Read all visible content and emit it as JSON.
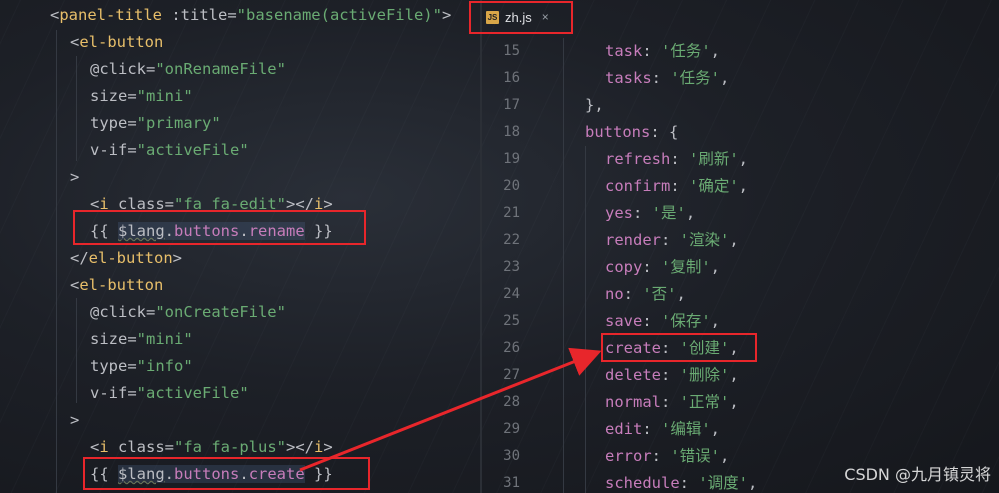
{
  "tab": {
    "icon_label": "JS",
    "name": "zh.js",
    "close": "×"
  },
  "left_lines": [
    {
      "parts": [
        [
          "t-punc",
          "<"
        ],
        [
          "t-tag",
          "panel-title "
        ],
        [
          "t-attr",
          ":title="
        ],
        [
          "t-str",
          "\"basename(activeFile)\""
        ],
        [
          "t-punc",
          ">"
        ]
      ]
    },
    {
      "parts": [
        [
          "t-punc",
          "<"
        ],
        [
          "t-tag",
          "el-button"
        ]
      ]
    },
    {
      "parts": [
        [
          "t-attr",
          "@click="
        ],
        [
          "t-str",
          "\"onRenameFile\""
        ]
      ]
    },
    {
      "parts": [
        [
          "t-attr",
          "size="
        ],
        [
          "t-str",
          "\"mini\""
        ]
      ]
    },
    {
      "parts": [
        [
          "t-attr",
          "type="
        ],
        [
          "t-str",
          "\"primary\""
        ]
      ]
    },
    {
      "parts": [
        [
          "t-attr",
          "v-if="
        ],
        [
          "t-str",
          "\"activeFile\""
        ]
      ]
    },
    {
      "parts": [
        [
          "t-punc",
          ">"
        ]
      ]
    },
    {
      "parts": [
        [
          "t-punc",
          "<"
        ],
        [
          "t-tag",
          "i "
        ],
        [
          "t-attr",
          "class="
        ],
        [
          "t-str",
          "\"fa fa-edit\""
        ],
        [
          "t-punc",
          "></"
        ],
        [
          "t-tag",
          "i"
        ],
        [
          "t-punc",
          ">"
        ]
      ]
    },
    {
      "parts": [
        [
          "t-punc",
          "{{ "
        ],
        [
          "t-var",
          "$lang"
        ],
        [
          "t-punc",
          "."
        ],
        [
          "t-prop",
          "buttons"
        ],
        [
          "t-punc",
          "."
        ],
        [
          "t-prop",
          "rename"
        ],
        [
          "t-punc",
          " }}"
        ]
      ]
    },
    {
      "parts": [
        [
          "t-punc",
          "</"
        ],
        [
          "t-tag",
          "el-button"
        ],
        [
          "t-punc",
          ">"
        ]
      ]
    },
    {
      "parts": [
        [
          "t-punc",
          "<"
        ],
        [
          "t-tag",
          "el-button"
        ]
      ]
    },
    {
      "parts": [
        [
          "t-attr",
          "@click="
        ],
        [
          "t-str",
          "\"onCreateFile\""
        ]
      ]
    },
    {
      "parts": [
        [
          "t-attr",
          "size="
        ],
        [
          "t-str",
          "\"mini\""
        ]
      ]
    },
    {
      "parts": [
        [
          "t-attr",
          "type="
        ],
        [
          "t-str",
          "\"info\""
        ]
      ]
    },
    {
      "parts": [
        [
          "t-attr",
          "v-if="
        ],
        [
          "t-str",
          "\"activeFile\""
        ]
      ]
    },
    {
      "parts": [
        [
          "t-punc",
          ">"
        ]
      ]
    },
    {
      "parts": [
        [
          "t-punc",
          "<"
        ],
        [
          "t-tag",
          "i "
        ],
        [
          "t-attr",
          "class="
        ],
        [
          "t-str",
          "\"fa fa-plus\""
        ],
        [
          "t-punc",
          "></"
        ],
        [
          "t-tag",
          "i"
        ],
        [
          "t-punc",
          ">"
        ]
      ]
    },
    {
      "parts": [
        [
          "t-punc",
          "{{ "
        ],
        [
          "t-var",
          "$lang"
        ],
        [
          "t-punc",
          "."
        ],
        [
          "t-prop",
          "buttons"
        ],
        [
          "t-punc",
          "."
        ],
        [
          "t-prop",
          "create"
        ],
        [
          "t-punc",
          " }}"
        ]
      ]
    }
  ],
  "right_lines": [
    {
      "num": "15",
      "parts": [
        [
          "t-key",
          "task"
        ],
        [
          "t-punc",
          ": "
        ],
        [
          "t-str",
          "'任务'"
        ],
        [
          "t-punc",
          ","
        ]
      ]
    },
    {
      "num": "16",
      "parts": [
        [
          "t-key",
          "tasks"
        ],
        [
          "t-punc",
          ": "
        ],
        [
          "t-str",
          "'任务'"
        ],
        [
          "t-punc",
          ","
        ]
      ]
    },
    {
      "num": "17",
      "parts": [
        [
          "t-punc",
          "},"
        ]
      ]
    },
    {
      "num": "18",
      "parts": [
        [
          "t-key",
          "buttons"
        ],
        [
          "t-punc",
          ": {"
        ]
      ]
    },
    {
      "num": "19",
      "parts": [
        [
          "t-key",
          "refresh"
        ],
        [
          "t-punc",
          ": "
        ],
        [
          "t-str",
          "'刷新'"
        ],
        [
          "t-punc",
          ","
        ]
      ]
    },
    {
      "num": "20",
      "parts": [
        [
          "t-key",
          "confirm"
        ],
        [
          "t-punc",
          ": "
        ],
        [
          "t-str",
          "'确定'"
        ],
        [
          "t-punc",
          ","
        ]
      ]
    },
    {
      "num": "21",
      "parts": [
        [
          "t-key",
          "yes"
        ],
        [
          "t-punc",
          ": "
        ],
        [
          "t-str",
          "'是'"
        ],
        [
          "t-punc",
          ","
        ]
      ]
    },
    {
      "num": "22",
      "parts": [
        [
          "t-key",
          "render"
        ],
        [
          "t-punc",
          ": "
        ],
        [
          "t-str",
          "'渲染'"
        ],
        [
          "t-punc",
          ","
        ]
      ]
    },
    {
      "num": "23",
      "parts": [
        [
          "t-key",
          "copy"
        ],
        [
          "t-punc",
          ": "
        ],
        [
          "t-str",
          "'复制'"
        ],
        [
          "t-punc",
          ","
        ]
      ]
    },
    {
      "num": "24",
      "parts": [
        [
          "t-key",
          "no"
        ],
        [
          "t-punc",
          ": "
        ],
        [
          "t-str",
          "'否'"
        ],
        [
          "t-punc",
          ","
        ]
      ]
    },
    {
      "num": "25",
      "parts": [
        [
          "t-key",
          "save"
        ],
        [
          "t-punc",
          ": "
        ],
        [
          "t-str",
          "'保存'"
        ],
        [
          "t-punc",
          ","
        ]
      ]
    },
    {
      "num": "26",
      "parts": [
        [
          "t-key",
          "create"
        ],
        [
          "t-punc",
          ": "
        ],
        [
          "t-str",
          "'创建'"
        ],
        [
          "t-punc",
          ","
        ]
      ]
    },
    {
      "num": "27",
      "parts": [
        [
          "t-key",
          "delete"
        ],
        [
          "t-punc",
          ": "
        ],
        [
          "t-str",
          "'删除'"
        ],
        [
          "t-punc",
          ","
        ]
      ]
    },
    {
      "num": "28",
      "parts": [
        [
          "t-key",
          "normal"
        ],
        [
          "t-punc",
          ": "
        ],
        [
          "t-str",
          "'正常'"
        ],
        [
          "t-punc",
          ","
        ]
      ]
    },
    {
      "num": "29",
      "parts": [
        [
          "t-key",
          "edit"
        ],
        [
          "t-punc",
          ": "
        ],
        [
          "t-str",
          "'编辑'"
        ],
        [
          "t-punc",
          ","
        ]
      ]
    },
    {
      "num": "30",
      "parts": [
        [
          "t-key",
          "error"
        ],
        [
          "t-punc",
          ": "
        ],
        [
          "t-str",
          "'错误'"
        ],
        [
          "t-punc",
          ","
        ]
      ]
    },
    {
      "num": "31",
      "parts": [
        [
          "t-key",
          "schedule"
        ],
        [
          "t-punc",
          ": "
        ],
        [
          "t-str",
          "'调度'"
        ],
        [
          "t-punc",
          ","
        ]
      ]
    }
  ],
  "watermark": "CSDN @九月镇灵将",
  "colors": {
    "annotation_red": "#e8262b",
    "tag": "#e8bf6a",
    "string": "#6aab73",
    "property": "#c77dbb"
  }
}
